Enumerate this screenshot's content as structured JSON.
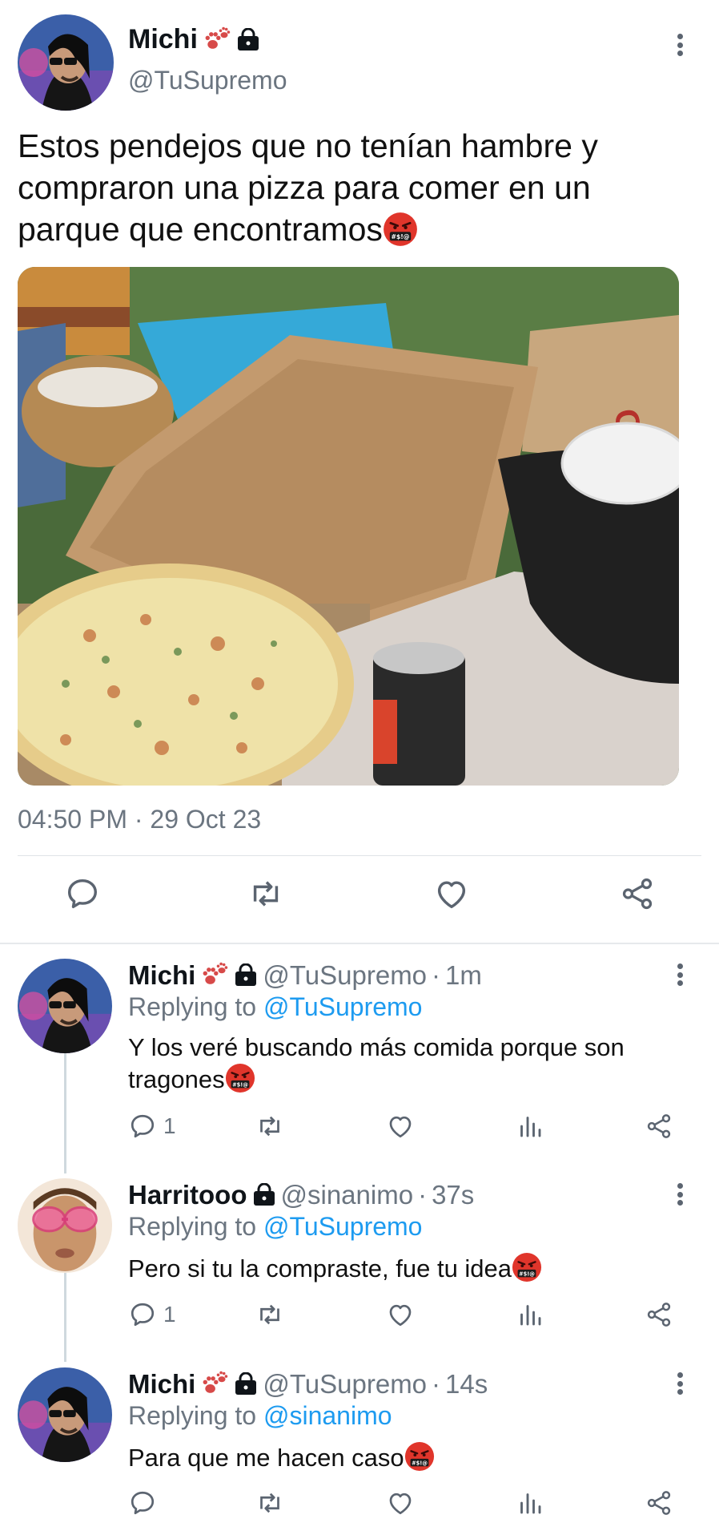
{
  "main_tweet": {
    "author_name": "Michi",
    "author_handle": "@TuSupremo",
    "text": "Estos pendejos que no tenían hambre y compraron una pizza para comer en un parque que encontramos",
    "timestamp": "04:50 PM · 29 Oct 23",
    "actions": [
      "reply-icon",
      "retweet-icon",
      "like-icon",
      "share-icon"
    ]
  },
  "replies": [
    {
      "author_name": "Michi",
      "author_handle": "@TuSupremo",
      "time": "1m",
      "replying_prefix": "Replying to",
      "replying_to": "@TuSupremo",
      "text": "Y los veré buscando más comida porque son tragones",
      "reply_count": "1"
    },
    {
      "author_name": "Harritooo",
      "author_handle": "@sinanimo",
      "time": "37s",
      "replying_prefix": "Replying to",
      "replying_to": "@TuSupremo",
      "text": "Pero si tu la compraste, fue tu idea",
      "reply_count": "1"
    },
    {
      "author_name": "Michi",
      "author_handle": "@TuSupremo",
      "time": "14s",
      "replying_prefix": "Replying to",
      "replying_to": "@sinanimo",
      "text": "Para que me hacen caso",
      "reply_count": ""
    }
  ],
  "colors": {
    "link": "#1d9bf0",
    "secondary_text": "#6b7580",
    "primary_text": "#0f1419"
  }
}
